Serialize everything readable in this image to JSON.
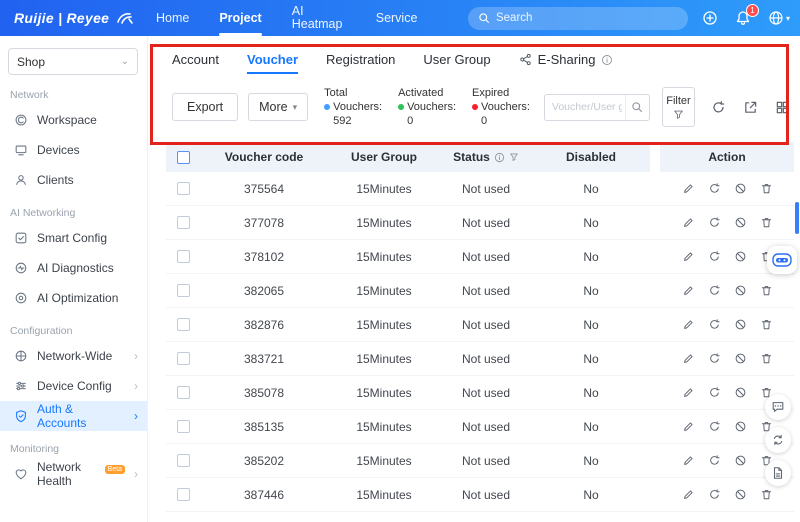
{
  "colors": {
    "topbar_blue": "#2a7df6",
    "accent": "#1677ff",
    "annotation_red": "#e2241d",
    "total_dot": "#409eff",
    "activated_dot": "#2fc25b",
    "expired_dot": "#f5222d",
    "notification_badge_bg": "#ff4d4f"
  },
  "icons": {
    "search": "magnifier",
    "notification": "bell",
    "language": "globe",
    "filter": "funnel",
    "edit": "pencil",
    "renew": "circular-arrow",
    "disable": "ban-circle",
    "delete": "trash"
  },
  "topnav": {
    "brand": "Ruijie | Reyee",
    "items": [
      {
        "label": "Home"
      },
      {
        "label": "Project"
      },
      {
        "label": "AI Heatmap"
      },
      {
        "label": "Service"
      }
    ],
    "search_placeholder": "Search",
    "notification_badge": "1"
  },
  "sidebar": {
    "site_selector": "Shop",
    "sections": [
      {
        "title": "Network",
        "items": [
          {
            "label": "Workspace"
          },
          {
            "label": "Devices"
          },
          {
            "label": "Clients"
          }
        ]
      },
      {
        "title": "AI Networking",
        "items": [
          {
            "label": "Smart Config"
          },
          {
            "label": "AI Diagnostics"
          },
          {
            "label": "AI Optimization"
          }
        ]
      },
      {
        "title": "Configuration",
        "items": [
          {
            "label": "Network-Wide"
          },
          {
            "label": "Device Config"
          },
          {
            "label": "Auth & Accounts"
          }
        ]
      },
      {
        "title": "Monitoring",
        "items": [
          {
            "label": "Network Health",
            "badge": "Beta"
          }
        ]
      }
    ]
  },
  "tabs": [
    {
      "label": "Account"
    },
    {
      "label": "Voucher"
    },
    {
      "label": "Registration"
    },
    {
      "label": "User Group"
    },
    {
      "label": "E-Sharing"
    }
  ],
  "toolbar": {
    "export_label": "Export",
    "more_label": "More",
    "stats": [
      {
        "top": "Total",
        "mid": "Vouchers:",
        "value": "592",
        "color": "#409eff"
      },
      {
        "top": "Activated",
        "mid": "Vouchers:",
        "value": "0",
        "color": "#2fc25b"
      },
      {
        "top": "Expired",
        "mid": "Vouchers:",
        "value": "0",
        "color": "#f5222d"
      }
    ],
    "search_placeholder": "Voucher/User group",
    "filter_label": "Filter"
  },
  "table": {
    "columns": [
      "Voucher code",
      "User Group",
      "Status",
      "Disabled",
      "Action"
    ],
    "rows": [
      {
        "code": "375564",
        "group": "15Minutes",
        "status": "Not used",
        "disabled": "No"
      },
      {
        "code": "377078",
        "group": "15Minutes",
        "status": "Not used",
        "disabled": "No"
      },
      {
        "code": "378102",
        "group": "15Minutes",
        "status": "Not used",
        "disabled": "No"
      },
      {
        "code": "382065",
        "group": "15Minutes",
        "status": "Not used",
        "disabled": "No"
      },
      {
        "code": "382876",
        "group": "15Minutes",
        "status": "Not used",
        "disabled": "No"
      },
      {
        "code": "383721",
        "group": "15Minutes",
        "status": "Not used",
        "disabled": "No"
      },
      {
        "code": "385078",
        "group": "15Minutes",
        "status": "Not used",
        "disabled": "No"
      },
      {
        "code": "385135",
        "group": "15Minutes",
        "status": "Not used",
        "disabled": "No"
      },
      {
        "code": "385202",
        "group": "15Minutes",
        "status": "Not used",
        "disabled": "No"
      },
      {
        "code": "387446",
        "group": "15Minutes",
        "status": "Not used",
        "disabled": "No"
      }
    ]
  }
}
